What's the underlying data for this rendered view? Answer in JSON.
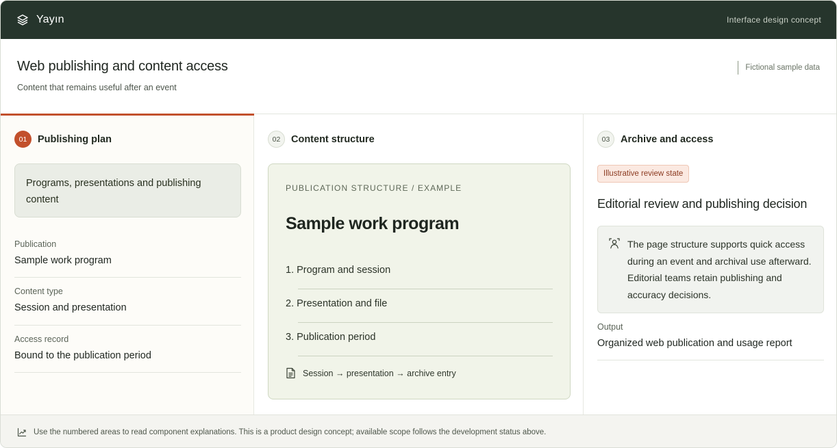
{
  "topbar": {
    "brand_icon": "layers-icon",
    "brand_name": "Yayın",
    "right_label": "Interface design concept"
  },
  "header": {
    "title": "Web publishing and content access",
    "subtitle": "Content that remains useful after an event",
    "sample_note": "Fictional sample data"
  },
  "columns": [
    {
      "number": "01",
      "title": "Publishing plan",
      "active": true,
      "plan_box": "Programs, presentations and publishing content",
      "fields": [
        {
          "label": "Publication",
          "value": "Sample work program"
        },
        {
          "label": "Content type",
          "value": "Session and presentation"
        },
        {
          "label": "Access record",
          "value": "Bound to the publication period"
        }
      ]
    },
    {
      "number": "02",
      "title": "Content structure",
      "active": false,
      "card": {
        "eyebrow": "PUBLICATION STRUCTURE / EXAMPLE",
        "title": "Sample work program",
        "steps": [
          "1. Program and session",
          "2. Presentation and file",
          "3. Publication period"
        ],
        "footer_icon": "document-icon",
        "footer": "Session → presentation → archive entry"
      }
    },
    {
      "number": "03",
      "title": "Archive and access",
      "active": false,
      "badge": "Illustrative review state",
      "review_title": "Editorial review and publishing decision",
      "note_icon": "reviewer-icon",
      "note": "The page structure supports quick access during an event and archival use afterward. Editorial teams retain publishing and accuracy decisions.",
      "output": {
        "label": "Output",
        "value": "Organized web publication and usage report"
      }
    }
  ],
  "footer": {
    "icon": "chart-trend-icon",
    "text": "Use the numbered areas to read component explanations. This is a product design concept; available scope follows the development status above."
  },
  "colors": {
    "topbar": "#26352c",
    "accent": "#c2502c",
    "card_bg": "#f1f4e9"
  }
}
